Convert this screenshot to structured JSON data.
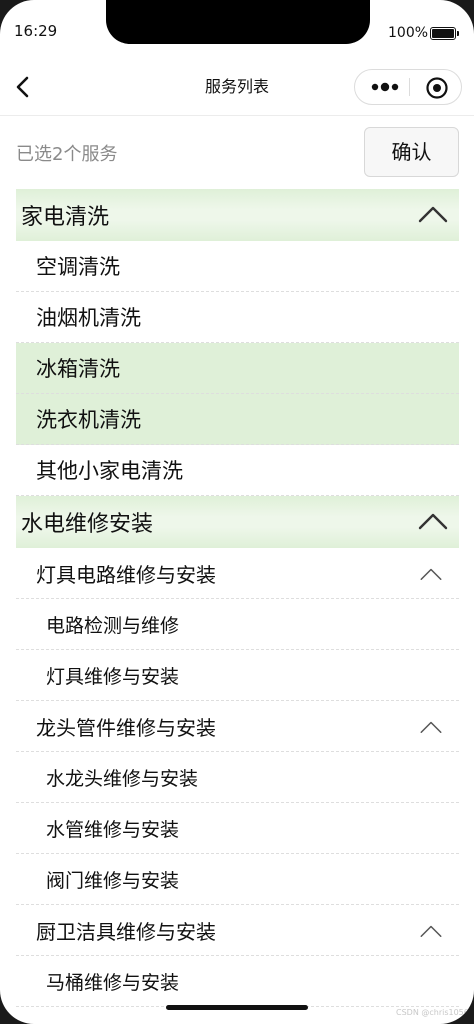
{
  "status": {
    "time": "16:29",
    "battery": "100%"
  },
  "nav": {
    "title": "服务列表"
  },
  "header": {
    "selected_count": "已选2个服务",
    "confirm_label": "确认"
  },
  "list": [
    {
      "kind": "cat",
      "label": "家电清洗",
      "expanded": true
    },
    {
      "kind": "item",
      "label": "空调清洗",
      "selected": false
    },
    {
      "kind": "item",
      "label": "油烟机清洗",
      "selected": false
    },
    {
      "kind": "item",
      "label": "冰箱清洗",
      "selected": true
    },
    {
      "kind": "item",
      "label": "洗衣机清洗",
      "selected": true
    },
    {
      "kind": "item",
      "label": "其他小家电清洗",
      "selected": false
    },
    {
      "kind": "cat",
      "label": "水电维修安装",
      "expanded": true
    },
    {
      "kind": "sub",
      "label": "灯具电路维修与安装",
      "expanded": true
    },
    {
      "kind": "leaf",
      "label": "电路检测与维修",
      "selected": false
    },
    {
      "kind": "leaf",
      "label": "灯具维修与安装",
      "selected": false
    },
    {
      "kind": "sub",
      "label": "龙头管件维修与安装",
      "expanded": true
    },
    {
      "kind": "leaf",
      "label": "水龙头维修与安装",
      "selected": false
    },
    {
      "kind": "leaf",
      "label": "水管维修与安装",
      "selected": false
    },
    {
      "kind": "leaf",
      "label": "阀门维修与安装",
      "selected": false
    },
    {
      "kind": "sub",
      "label": "厨卫洁具维修与安装",
      "expanded": true
    },
    {
      "kind": "leaf",
      "label": "马桶维修与安装",
      "selected": false
    }
  ],
  "icons": {
    "back": "chevron-left-icon",
    "more": "more-dots-icon",
    "close": "target-icon",
    "collapse": "chevron-up-icon"
  },
  "colors": {
    "selected_bg": "#dff0d8",
    "category_bg": "#dff0d8"
  },
  "watermark": "CSDN @chris1056"
}
